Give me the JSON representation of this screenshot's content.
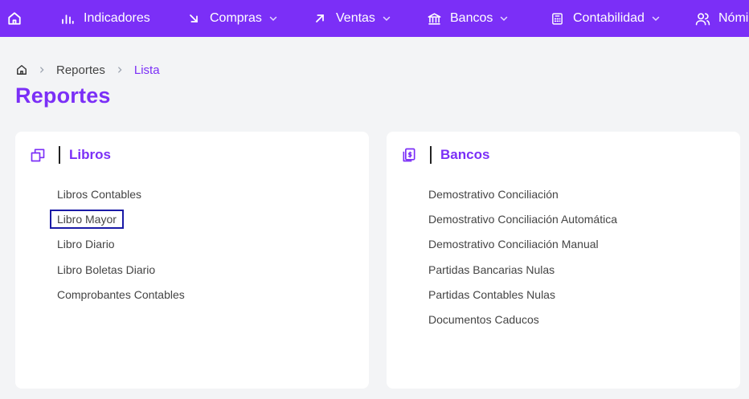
{
  "nav": {
    "items": [
      {
        "label": "Indicadores",
        "icon": "bar-chart-icon",
        "dropdown": false
      },
      {
        "label": "Compras",
        "icon": "arrow-down-right-icon",
        "dropdown": true
      },
      {
        "label": "Ventas",
        "icon": "arrow-up-right-icon",
        "dropdown": true
      },
      {
        "label": "Bancos",
        "icon": "bank-icon",
        "dropdown": true
      },
      {
        "label": "Contabilidad",
        "icon": "calculator-icon",
        "dropdown": true
      },
      {
        "label": "Nómina",
        "icon": "users-icon",
        "dropdown": false
      }
    ]
  },
  "breadcrumb": {
    "items": [
      "Reportes",
      "Lista"
    ]
  },
  "page": {
    "title": "Reportes"
  },
  "cards": [
    {
      "title": "Libros",
      "icon": "copy-icon",
      "items": [
        "Libros Contables",
        "Libro Mayor",
        "Libro Diario",
        "Libro Boletas Diario",
        "Comprobantes Contables"
      ],
      "selected_index": 1
    },
    {
      "title": "Bancos",
      "icon": "document-money-icon",
      "items": [
        "Demostrativo Conciliación",
        "Demostrativo Conciliación Automática",
        "Demostrativo Conciliación Manual",
        "Partidas Bancarias Nulas",
        "Partidas Contables Nulas",
        "Documentos Caducos"
      ]
    }
  ],
  "colors": {
    "brand": "#7b2ff7",
    "selection_border": "#1a1aa6",
    "page_background": "#f3f4f6"
  }
}
